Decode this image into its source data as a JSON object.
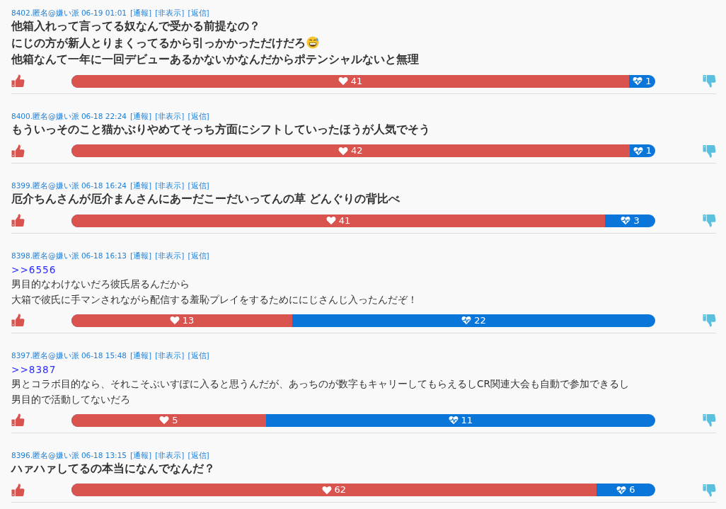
{
  "posts": [
    {
      "header": "8402.匿名@嫌い派 06-19 01:01",
      "actions": [
        "[通報]",
        "[非表示]",
        "[返信]"
      ],
      "kind": "emphasized",
      "lines": [
        {
          "text": "他箱入れって言ってる奴なんで受かる前提なの？",
          "emoji": false
        },
        {
          "text": "にじの方が新人とりまくってるから引っかかっただけだろ",
          "emoji": true
        },
        {
          "text": "他箱なんて一年に一回デビューあるかないかなんだからポテンシャルないと無理",
          "emoji": false
        }
      ],
      "votes": {
        "likes": "41",
        "dislikes": "1",
        "level": 0.955
      }
    },
    {
      "header": "8400.匿名@嫌い派 06-18 22:24",
      "actions": [
        "[通報]",
        "[非表示]",
        "[返信]"
      ],
      "kind": "emphasized",
      "lines": [
        {
          "text": "もういっそのこと猫かぶりやめてそっち方面にシフトしていったほうが人気でそう",
          "emoji": false
        }
      ],
      "votes": {
        "likes": "42",
        "dislikes": "1",
        "level": 0.956
      }
    },
    {
      "header": "8399.匿名@嫌い派 06-18 16:24",
      "actions": [
        "[通報]",
        "[非表示]",
        "[返信]"
      ],
      "kind": "emphasized",
      "lines": [
        {
          "text": "厄介ちんさんが厄介まんさんにあーだこーだいってんの草 どんぐりの背比べ",
          "emoji": false
        }
      ],
      "votes": {
        "likes": "41",
        "dislikes": "3",
        "level": 0.914
      }
    },
    {
      "header": "8398.匿名@嫌い派 06-18 16:13",
      "actions": [
        "[通報]",
        "[非表示]",
        "[返信]"
      ],
      "kind": "plain",
      "reply_to": ">>6556",
      "lines": [
        {
          "text": "男目的なわけないだろ彼氏居るんだから",
          "emoji": false
        },
        {
          "text": "大箱で彼氏に手マンされながら配信する羞恥プレイをするためににじさんじ入ったんだぞ！",
          "emoji": false
        }
      ],
      "votes": {
        "likes": "13",
        "dislikes": "22",
        "level": 0.378
      }
    },
    {
      "header": "8397.匿名@嫌い派 06-18 15:48",
      "actions": [
        "[通報]",
        "[非表示]",
        "[返信]"
      ],
      "kind": "plain",
      "reply_to": ">>8387",
      "lines": [
        {
          "text": "男とコラボ目的なら、それこそぶいすぽに入ると思うんだが、あっちのが数字もキャリーしてもらえるしCR関連大会も自動で参加できるし",
          "emoji": false
        },
        {
          "text": "男目的で活動してないだろ",
          "emoji": false
        }
      ],
      "votes": {
        "likes": "5",
        "dislikes": "11",
        "level": 0.333
      }
    },
    {
      "header": "8396.匿名@嫌い派 06-18 13:15",
      "actions": [
        "[通報]",
        "[非表示]",
        "[返信]"
      ],
      "kind": "emphasized",
      "lines": [
        {
          "text": "ハァハァしてるの本当になんでなんだ？",
          "emoji": false
        }
      ],
      "votes": {
        "likes": "62",
        "dislikes": "6",
        "level": 0.899
      }
    }
  ]
}
